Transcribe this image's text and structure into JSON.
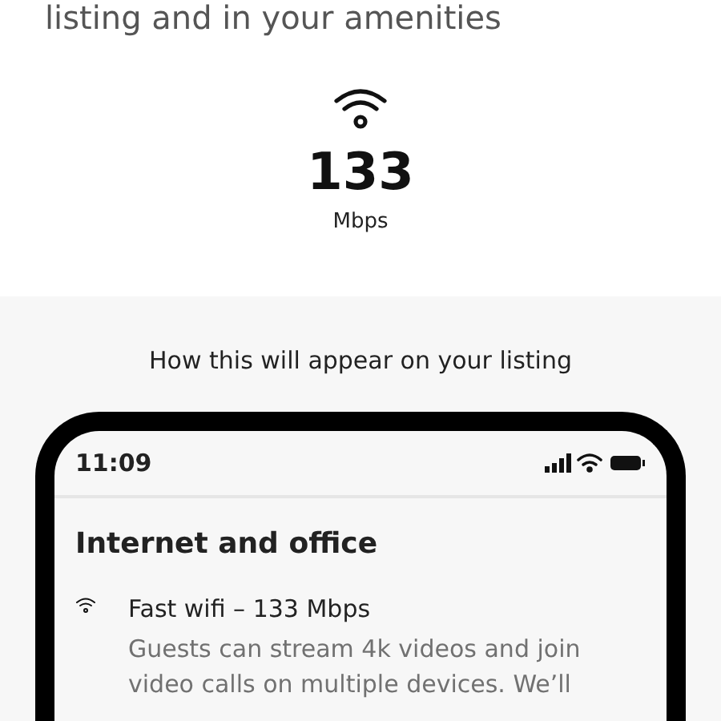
{
  "intro": {
    "text": "listing and in your amenities"
  },
  "speed": {
    "value": "133",
    "unit": "Mbps"
  },
  "preview": {
    "caption": "How this will appear on your listing",
    "phone": {
      "time": "11:09",
      "section_title": "Internet and office",
      "amenity": {
        "title": "Fast wifi – 133 Mbps",
        "description": [
          "Guests can stream 4k videos and join",
          "video calls on multiple devices. We’ll"
        ]
      }
    }
  }
}
